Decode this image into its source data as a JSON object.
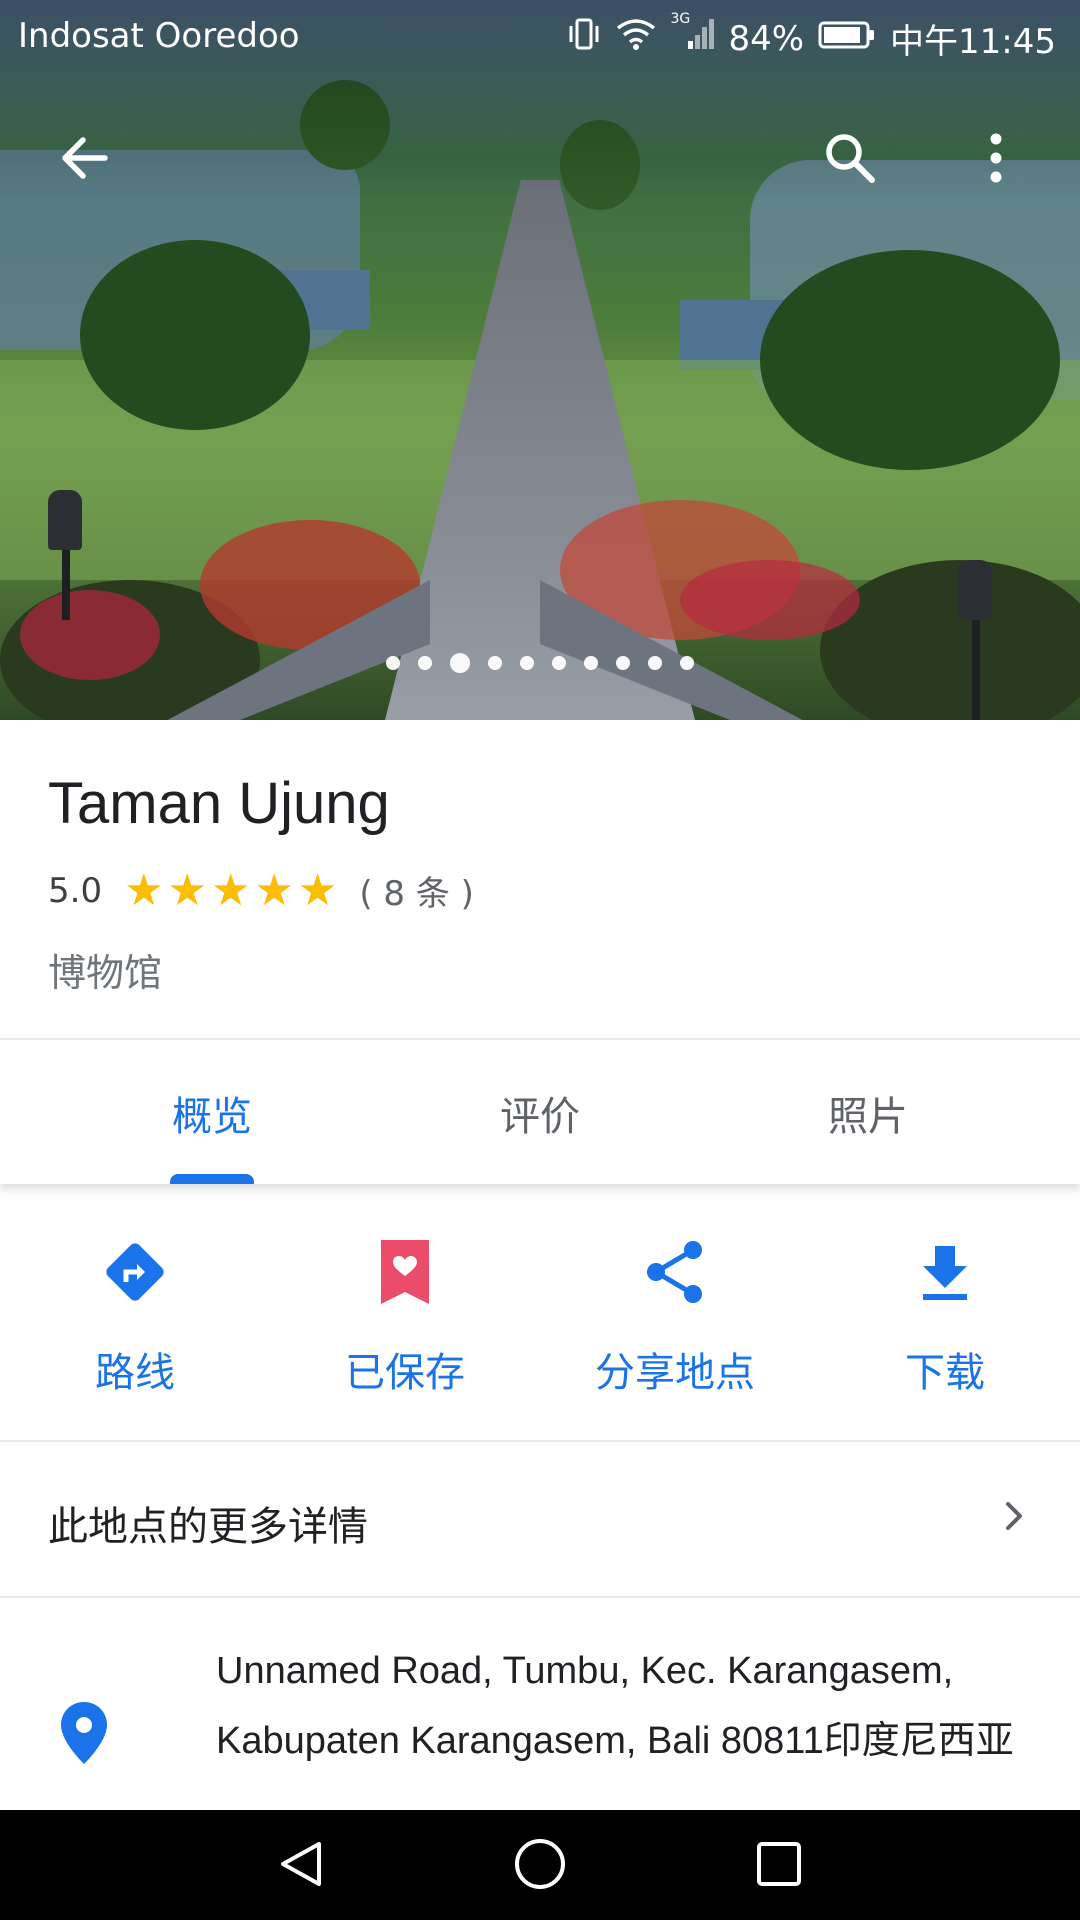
{
  "status_bar": {
    "carrier": "Indosat Ooredoo",
    "network": "3G",
    "battery": "84%",
    "time": "中午11:45"
  },
  "hero": {
    "photo_count": 10,
    "active_index": 2
  },
  "place": {
    "name": "Taman Ujung",
    "rating": "5.0",
    "stars": 5,
    "reviews": "( 8 条 )",
    "category": "博物馆"
  },
  "tabs": [
    {
      "label": "概览",
      "active": true
    },
    {
      "label": "评价",
      "active": false
    },
    {
      "label": "照片",
      "active": false
    }
  ],
  "actions": [
    {
      "label": "路线",
      "icon": "directions-icon"
    },
    {
      "label": "已保存",
      "icon": "saved-bookmark-icon"
    },
    {
      "label": "分享地点",
      "icon": "share-icon"
    },
    {
      "label": "下载",
      "icon": "download-icon"
    }
  ],
  "more_details": "此地点的更多详情",
  "address": "Unnamed Road, Tumbu, Kec. Karangasem, Kabupaten Karangasem, Bali 80811印度尼西亚",
  "colors": {
    "accent": "#1a73e8",
    "star": "#fbbc04",
    "saved": "#ea4c6a"
  }
}
